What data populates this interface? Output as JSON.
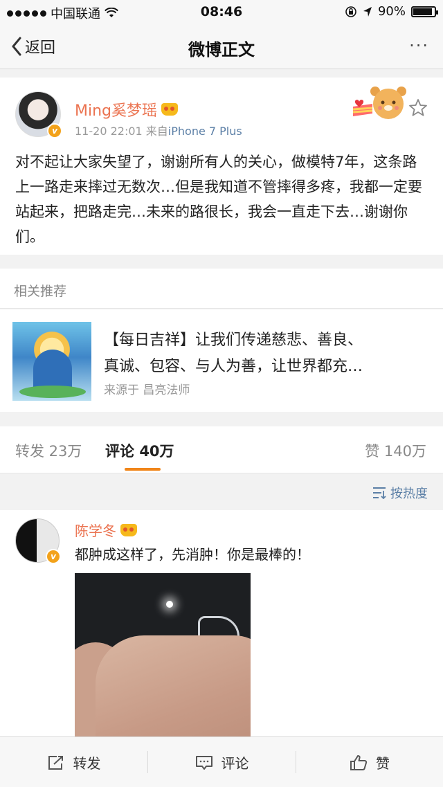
{
  "status_bar": {
    "carrier": "中国联通",
    "time": "08:46",
    "battery": "90%",
    "battery_level": 0.9
  },
  "nav": {
    "back_label": "返回",
    "title": "微博正文",
    "more_label": "···"
  },
  "post": {
    "author": "Ming奚梦瑶",
    "time": "11-20 22:01",
    "source_prefix": "来自",
    "source": "iPhone 7 Plus",
    "content": "对不起让大家失望了，谢谢所有人的关心，做模特7年，这条路上一路走来摔过无数次…但是我知道不管摔得多疼，我都一定要站起来，把路走完…未来的路很长，我会一直走下去…谢谢你们。"
  },
  "related": {
    "header": "相关推荐",
    "line1": "【每日吉祥】让我们传递慈悲、善良、",
    "line2": "真诚、包容、与人为善，让世界都充…",
    "source": "来源于 昌亮法师"
  },
  "tabs": {
    "repost": "转发 23万",
    "comments_label": "评论",
    "comments_count": "40万",
    "likes": "赞 140万"
  },
  "sort": {
    "label": "按热度"
  },
  "comment": {
    "author": "陈学冬",
    "text": "都肿成这样了，先消肿！你是最棒的！"
  },
  "toolbar": {
    "repost": "转发",
    "comment": "评论",
    "like": "赞"
  }
}
